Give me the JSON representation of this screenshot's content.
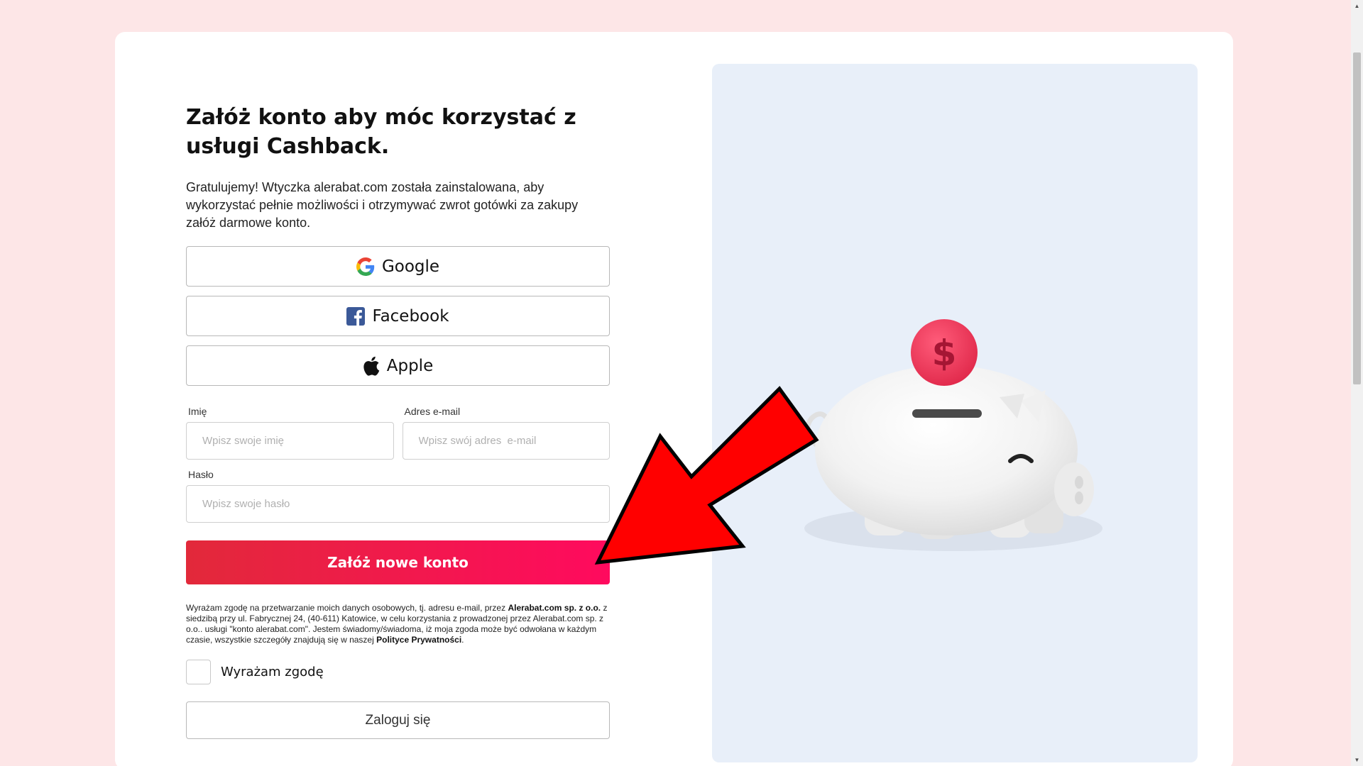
{
  "signup": {
    "title": "Załóż konto aby móc korzystać z usługi Cashback.",
    "intro": "Gratulujemy! Wtyczka alerabat.com została zainstalowana, aby wykorzystać pełnie możliwości i otrzymywać zwrot gotówki za zakupy załóż darmowe konto.",
    "social": [
      {
        "label": "Google",
        "icon": "google-icon"
      },
      {
        "label": "Facebook",
        "icon": "facebook-icon"
      },
      {
        "label": "Apple",
        "icon": "apple-icon"
      }
    ],
    "fields": {
      "name": {
        "label": "Imię",
        "placeholder": "Wpisz swoje imię",
        "value": ""
      },
      "email": {
        "label": "Adres e-mail",
        "placeholder": "Wpisz swój adres  e-mail",
        "value": ""
      },
      "password": {
        "label": "Hasło",
        "placeholder": "Wpisz swoje hasło",
        "value": ""
      }
    },
    "submit_label": "Załóż nowe konto",
    "consent": {
      "part1": "Wyrażam zgodę na przetwarzanie moich danych osobowych, tj. adresu e-mail, przez ",
      "company": "Alerabat.com sp. z o.o.",
      "part2": " z siedzibą przy ul. Fabrycznej 24, (40-611) Katowice, w celu korzystania z prowadzonej przez Alerabat.com sp. z o.o.. usługi \"konto alerabat.com\". Jestem świadomy/świadoma, iż moja zgoda może być odwołana w każdym czasie, wszystkie szczegóły znajdują się w naszej ",
      "policy_link": "Polityce Prywatności",
      "part3": "."
    },
    "checkbox_label": "Wyrażam zgodę",
    "checkbox_checked": false,
    "login_label": "Zaloguj się"
  },
  "illustration": {
    "coin_symbol": "$",
    "description_icon": "piggy-bank-icon"
  },
  "colors": {
    "page_bg": "#fde6e7",
    "panel_bg": "#e8eff9",
    "primary_start": "#e2293a",
    "primary_end": "#ff0a5e",
    "arrow": "#ff0000",
    "coin": "#f0395e"
  }
}
